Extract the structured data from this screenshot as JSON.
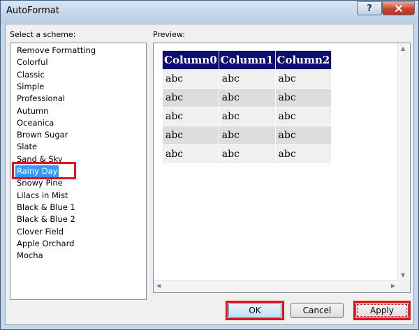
{
  "window": {
    "title": "AutoFormat",
    "help_label": "?",
    "close_label": "X"
  },
  "schemes": {
    "label": "Select a scheme:",
    "items": [
      "Remove Formatting",
      "Colorful",
      "Classic",
      "Simple",
      "Professional",
      "Autumn",
      "Oceanica",
      "Brown Sugar",
      "Slate",
      "Sand & Sky",
      "Rainy Day",
      "Snowy Pine",
      "Lilacs in Mist",
      "Black & Blue 1",
      "Black & Blue 2",
      "Clover Field",
      "Apple Orchard",
      "Mocha"
    ],
    "selected": "Rainy Day"
  },
  "preview": {
    "label": "Preview:",
    "columns": [
      "Column0",
      "Column1",
      "Column2"
    ],
    "rows": [
      [
        "abc",
        "abc",
        "abc"
      ],
      [
        "abc",
        "abc",
        "abc"
      ],
      [
        "abc",
        "abc",
        "abc"
      ],
      [
        "abc",
        "abc",
        "abc"
      ],
      [
        "abc",
        "abc",
        "abc"
      ]
    ],
    "header_color": "#0d0d73"
  },
  "buttons": {
    "ok": "OK",
    "cancel": "Cancel",
    "apply": "Apply"
  },
  "colors": {
    "selection": "#3399ff",
    "highlight_box": "#e0141e"
  }
}
